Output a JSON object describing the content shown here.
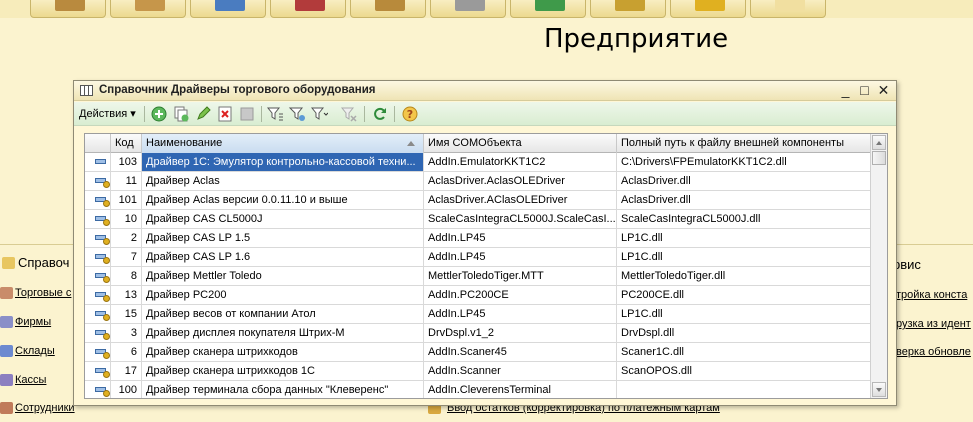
{
  "app": {
    "title": "Предприятие",
    "top_buttons": [
      {
        "icon": "boxes-icon",
        "color": "#b98a3e"
      },
      {
        "icon": "goods-icon",
        "color": "#c6964a"
      },
      {
        "icon": "tools-icon",
        "color": "#4a7cc0"
      },
      {
        "icon": "cart-icon",
        "color": "#b23b3b"
      },
      {
        "icon": "package-icon",
        "color": "#b88a3b"
      },
      {
        "icon": "terminal-icon",
        "color": "#9a9a9a"
      },
      {
        "icon": "globe-icon",
        "color": "#3f9a4a"
      },
      {
        "icon": "warehouse-icon",
        "color": "#c8a030"
      },
      {
        "icon": "coins-icon",
        "color": "#e0b020"
      },
      {
        "icon": "lifebuoy-icon",
        "color": "#f1dfa0"
      }
    ],
    "left_panel": {
      "title": "Справоч",
      "links": [
        "Торговые с",
        "Фирмы",
        "Склады",
        "Кассы",
        "Сотрудники"
      ]
    },
    "right_panel": {
      "title": "рвис",
      "links": [
        "тройка конста",
        "рузка из идент",
        "верка обновле"
      ]
    },
    "bottom_link": "Ввод остатков (корректировка) по платежным картам"
  },
  "window": {
    "title": "Справочник Драйверы торгового оборудования",
    "controls": {
      "minimize": "_",
      "maximize": "□",
      "close": "✕"
    },
    "toolbar": {
      "actions_label": "Действия ▾",
      "icons": [
        "add-icon",
        "copy-icon",
        "edit-icon",
        "delete-icon",
        "post-icon",
        "filter-icon",
        "filter-set-icon",
        "filter-list-icon",
        "filter-off-icon",
        "refresh-icon",
        "help-icon"
      ]
    }
  },
  "table": {
    "columns": [
      "Код",
      "Наименование",
      "Имя COMОбъекта",
      "Полный путь к файлу внешней компоненты"
    ],
    "rows": [
      {
        "code": "103",
        "name": "Драйвер 1С: Эмулятор контрольно-кассовой техни...",
        "com": "AddIn.EmulatorKKT1C2",
        "path": "C:\\Drivers\\FPEmulatorKKT1C2.dll",
        "icon": "plain",
        "selected": true
      },
      {
        "code": "11",
        "name": "Драйвер Aclas",
        "com": "AclasDriver.AclasOLEDriver",
        "path": "AclasDriver.dll",
        "icon": "sub"
      },
      {
        "code": "101",
        "name": "Драйвер Aclas версии 0.0.11.10 и выше",
        "com": "AclasDriver.AClasOLEDriver",
        "path": "AclasDriver.dll",
        "icon": "sub"
      },
      {
        "code": "10",
        "name": "Драйвер CAS CL5000J",
        "com": "ScaleCasIntegraCL5000J.ScaleCasI...",
        "path": "ScaleCasIntegraCL5000J.dll",
        "icon": "sub"
      },
      {
        "code": "2",
        "name": "Драйвер CAS LP 1.5",
        "com": "AddIn.LP45",
        "path": "LP1C.dll",
        "icon": "sub"
      },
      {
        "code": "7",
        "name": "Драйвер CAS LP 1.6",
        "com": "AddIn.LP45",
        "path": "LP1C.dll",
        "icon": "sub"
      },
      {
        "code": "8",
        "name": "Драйвер Mettler Toledo",
        "com": "MettlerToledoTiger.MTT",
        "path": "MettlerToledoTiger.dll",
        "icon": "sub"
      },
      {
        "code": "13",
        "name": "Драйвер PC200",
        "com": "AddIn.PC200CE",
        "path": "PC200CE.dll",
        "icon": "sub"
      },
      {
        "code": "15",
        "name": "Драйвер весов от компании Атол",
        "com": "AddIn.LP45",
        "path": "LP1C.dll",
        "icon": "sub"
      },
      {
        "code": "3",
        "name": "Драйвер дисплея покупателя Штрих-М",
        "com": "DrvDspl.v1_2",
        "path": "DrvDspl.dll",
        "icon": "sub"
      },
      {
        "code": "6",
        "name": "Драйвер сканера штрихкодов",
        "com": "AddIn.Scaner45",
        "path": "Scaner1C.dll",
        "icon": "sub"
      },
      {
        "code": "17",
        "name": "Драйвер сканера штрихкодов 1С",
        "com": "AddIn.Scanner",
        "path": "ScanOPOS.dll",
        "icon": "sub"
      },
      {
        "code": "100",
        "name": "Драйвер терминала сбора данных \"Клеверенс\"",
        "com": "AddIn.CleverensTerminal",
        "path": "",
        "icon": "sub"
      }
    ]
  }
}
